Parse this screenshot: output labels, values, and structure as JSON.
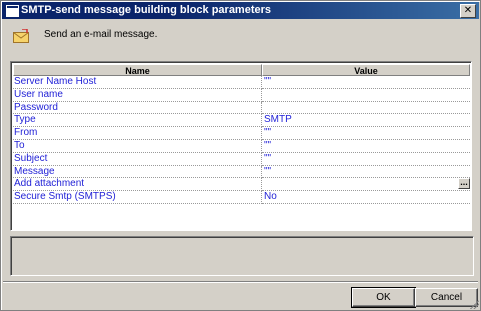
{
  "window": {
    "title": "SMTP-send message building block parameters",
    "close_glyph": "✕"
  },
  "description": {
    "icon": "envelope-icon",
    "text": "Send an e-mail message."
  },
  "grid": {
    "columns": {
      "name": "Name",
      "value": "Value"
    },
    "rows": [
      {
        "name": "Server Name Host",
        "value": "\"\""
      },
      {
        "name": "User name",
        "value": ""
      },
      {
        "name": "Password",
        "value": ""
      },
      {
        "name": "Type",
        "value": "SMTP"
      },
      {
        "name": "From",
        "value": "\"\""
      },
      {
        "name": "To",
        "value": "\"\""
      },
      {
        "name": "Subject",
        "value": "\"\""
      },
      {
        "name": "Message",
        "value": "\"\""
      },
      {
        "name": "Add attachment",
        "value": "",
        "button": "..."
      },
      {
        "name": "Secure Smtp (SMTPS)",
        "value": "No"
      }
    ]
  },
  "buttons": {
    "ok": "OK",
    "cancel": "Cancel"
  },
  "colors": {
    "titlebar": "#0a246a",
    "row_text": "#1f1fd6",
    "face": "#d4d0c8"
  }
}
